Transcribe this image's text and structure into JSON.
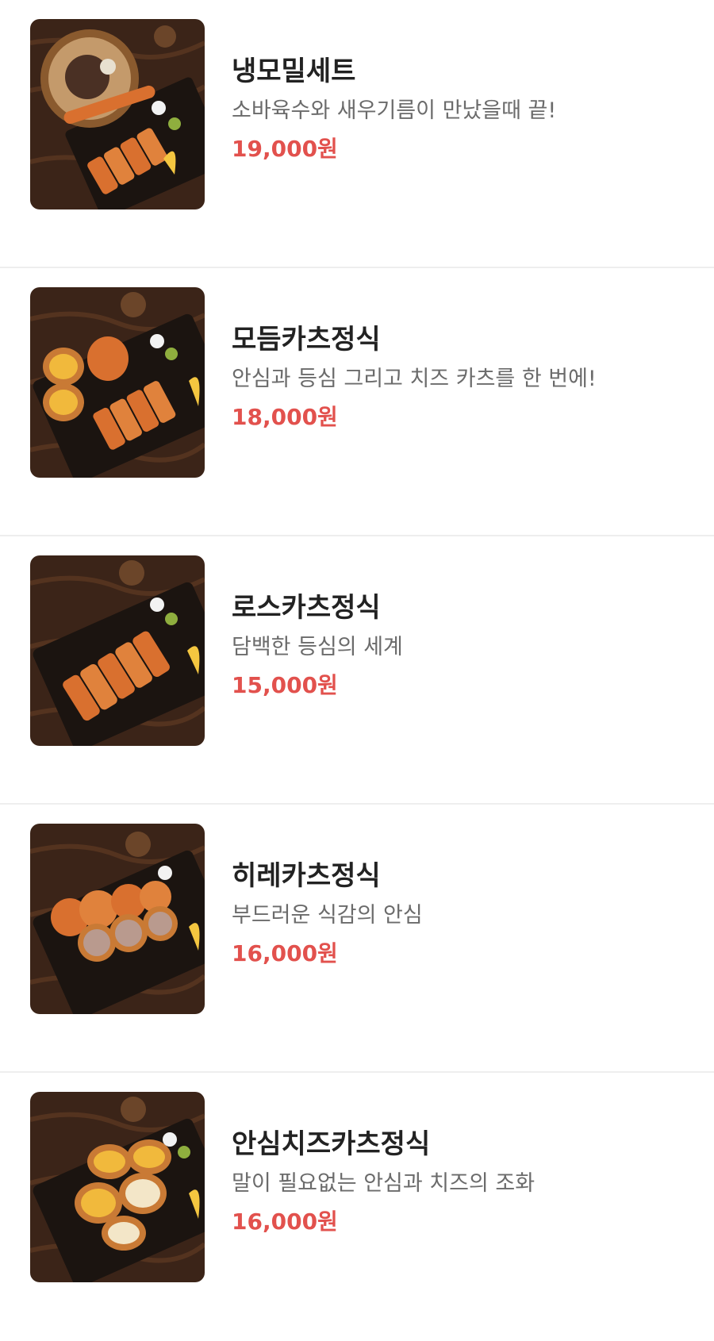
{
  "menu": {
    "items": [
      {
        "name": "냉모밀세트",
        "description": "소바육수와 새우기름이 만났을때 끝!",
        "price": "19,000원",
        "image_icon": "soba-tonkatsu-set-photo"
      },
      {
        "name": "모듬카츠정식",
        "description": "안심과 등심 그리고 치즈 카츠를 한 번에!",
        "price": "18,000원",
        "image_icon": "assorted-katsu-photo"
      },
      {
        "name": "로스카츠정식",
        "description": "담백한 등심의 세계",
        "price": "15,000원",
        "image_icon": "loin-katsu-photo"
      },
      {
        "name": "히레카츠정식",
        "description": "부드러운 식감의 안심",
        "price": "16,000원",
        "image_icon": "fillet-katsu-photo"
      },
      {
        "name": "안심치즈카츠정식",
        "description": "말이 필요없는 안심과 치즈의 조화",
        "price": "16,000원",
        "image_icon": "cheese-katsu-photo"
      }
    ]
  },
  "colors": {
    "price": "#e2514d",
    "title": "#222222",
    "description": "#6b6b6b",
    "divider": "#eeeeee",
    "wood": "#3b2418",
    "katsu": "#d9702f"
  }
}
